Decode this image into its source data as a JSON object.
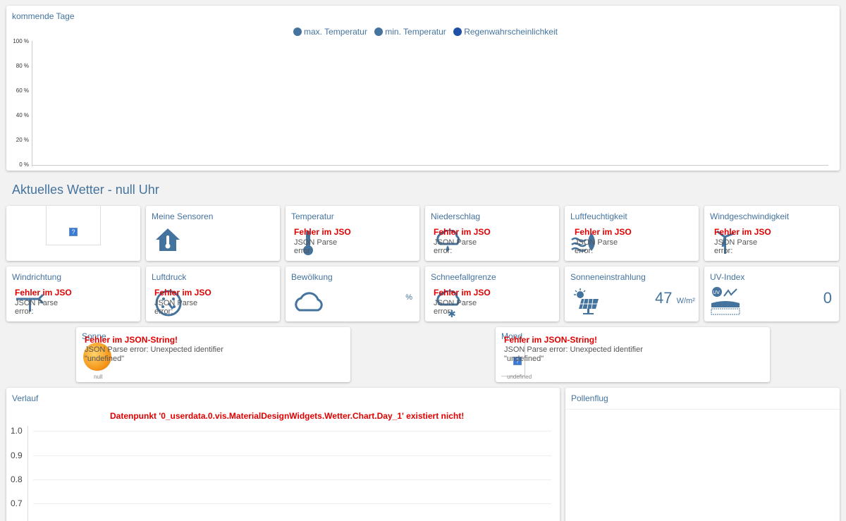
{
  "forecast": {
    "title": "kommende Tage",
    "legend": [
      {
        "label": "max. Temperatur",
        "color": "#44739e"
      },
      {
        "label": "min. Temperatur",
        "color": "#44739e"
      },
      {
        "label": "Regenwahrscheinlichkeit",
        "color": "#1f4fa6"
      }
    ],
    "yticks": [
      "100 %",
      "80 %",
      "60 %",
      "40 %",
      "20 %",
      "0 %"
    ]
  },
  "current": {
    "heading": "Aktuelles Wetter - null Uhr"
  },
  "tiles": {
    "sensors": "Meine Sensoren",
    "temperatur": "Temperatur",
    "niederschlag": "Niederschlag",
    "luftfeuchtigkeit": "Luftfeuchtigkeit",
    "windgeschwindigkeit": "Windgeschwindigkeit",
    "windrichtung": "Windrichtung",
    "luftdruck": "Luftdruck",
    "bewoelkung": "Bewölkung",
    "bewoelkung_unit": "%",
    "schneefallgrenze": "Schneefallgrenze",
    "sonneneinstrahlung": "Sonneneinstrahlung",
    "sonneneinstrahlung_value": "47",
    "sonneneinstrahlung_unit": "W/m²",
    "uvindex": "UV-Index",
    "uvindex_value": "0"
  },
  "errors": {
    "short_title": "Fehler im JSO",
    "short_line1": "JSON Parse",
    "short_line2": "error:",
    "long_title": "Fehler im JSON-String!",
    "long_line1": "JSON Parse error: Unexpected identifier",
    "long_line2": "\"undefined\""
  },
  "sun": {
    "label": "Sonne",
    "caption": "null"
  },
  "moon": {
    "label": "Mond",
    "caption": "undefined"
  },
  "history": {
    "title": "Verlauf",
    "error": "Datenpunkt '0_userdata.0.vis.MaterialDesignWidgets.Wetter.Chart.Day_1' existiert nicht!",
    "yticks": [
      "1.0",
      "0.9",
      "0.8",
      "0.7"
    ]
  },
  "pollen": {
    "title": "Pollenflug"
  }
}
